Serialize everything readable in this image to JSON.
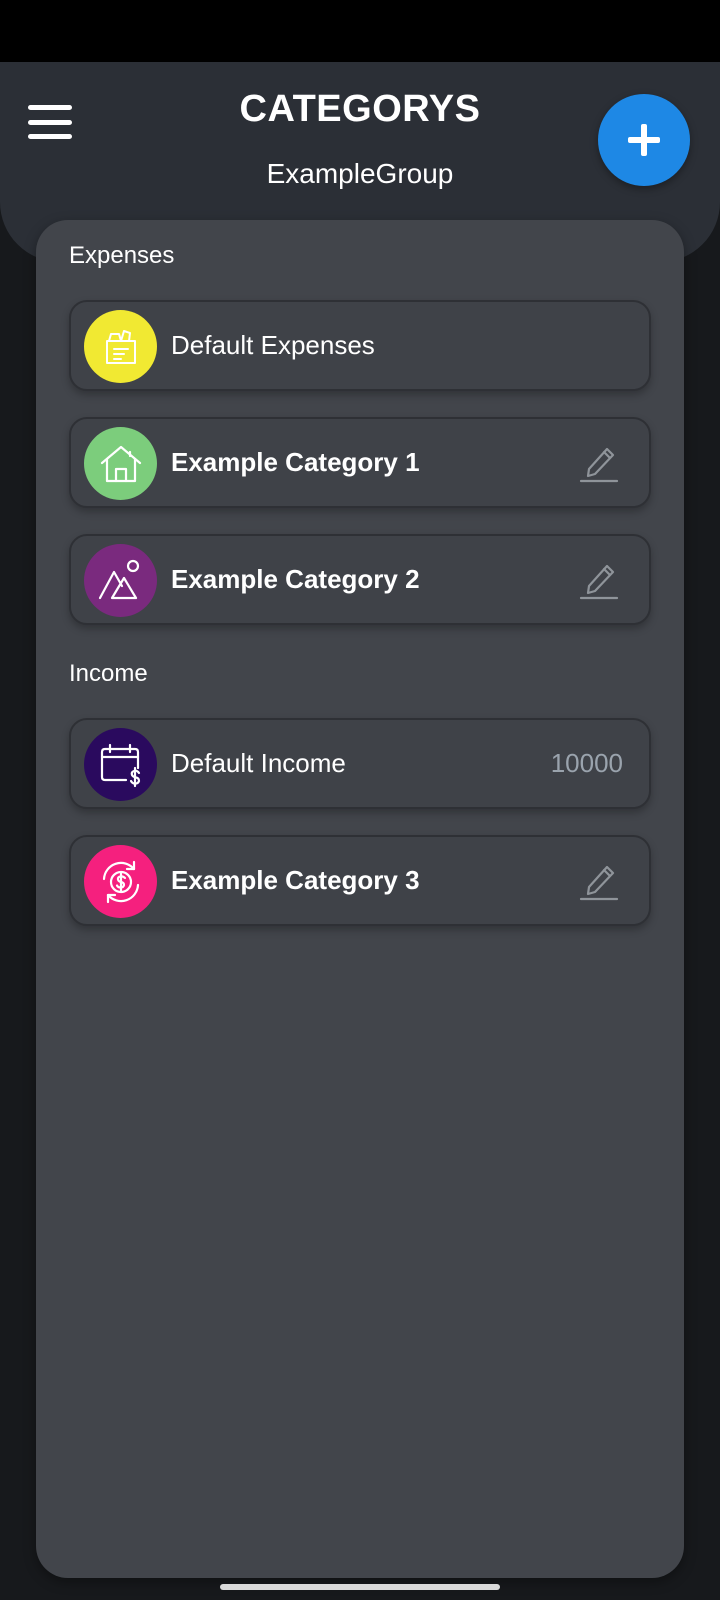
{
  "header": {
    "title": "CATEGORYS",
    "subtitle": "ExampleGroup",
    "menu_icon": "hamburger-menu-icon",
    "add_icon": "plus-icon"
  },
  "sections": {
    "expenses": {
      "label": "Expenses",
      "items": [
        {
          "name": "Default Expenses",
          "icon": "grocery-bag-icon",
          "color": "#f1e932",
          "editable": false
        },
        {
          "name": "Example Category 1",
          "icon": "house-icon",
          "color": "#7ccd7c",
          "editable": true
        },
        {
          "name": "Example Category 2",
          "icon": "shapes-icon",
          "color": "#7a2a7e",
          "editable": true
        }
      ]
    },
    "income": {
      "label": "Income",
      "items": [
        {
          "name": "Default Income",
          "value": "10000",
          "icon": "calendar-dollar-icon",
          "color": "#2a0a5e",
          "editable": false
        },
        {
          "name": "Example Category 3",
          "icon": "dollar-exchange-icon",
          "color": "#f5207e",
          "editable": true
        }
      ]
    }
  },
  "colors": {
    "accent": "#1e88e5",
    "header_bg": "#2b2f36",
    "panel_bg": "#42454b"
  }
}
